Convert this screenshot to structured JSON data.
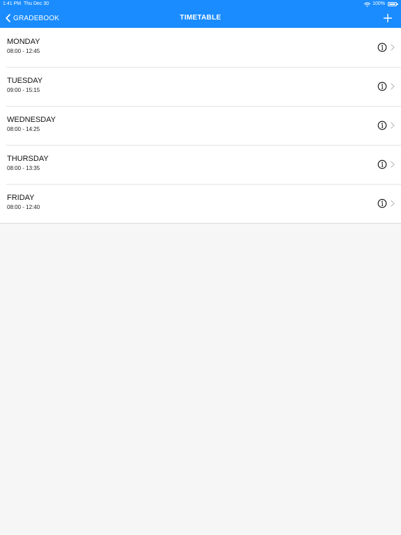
{
  "status_bar": {
    "time": "1:41 PM",
    "date": "Thu Dec 30",
    "battery": "100%"
  },
  "nav": {
    "back_label": "GRADEBOOK",
    "title": "TIMETABLE",
    "icons": [
      "chevron-left-icon",
      "plus-icon",
      "info-icon",
      "chevron-right-icon",
      "wifi-icon",
      "battery-icon"
    ]
  },
  "days": [
    {
      "name": "MONDAY",
      "hours": "08:00 - 12:45"
    },
    {
      "name": "TUESDAY",
      "hours": "09:00 - 15:15"
    },
    {
      "name": "WEDNESDAY",
      "hours": "08:00 - 14:25"
    },
    {
      "name": "THURSDAY",
      "hours": "08:00 - 13:35"
    },
    {
      "name": "FRIDAY",
      "hours": "08:00 - 12:40"
    }
  ],
  "colors": {
    "header_bg": "#1a8cff",
    "page_bg": "#f6f6f6",
    "row_bg": "#ffffff",
    "text": "#111111",
    "chevron": "#bbbbbb"
  }
}
